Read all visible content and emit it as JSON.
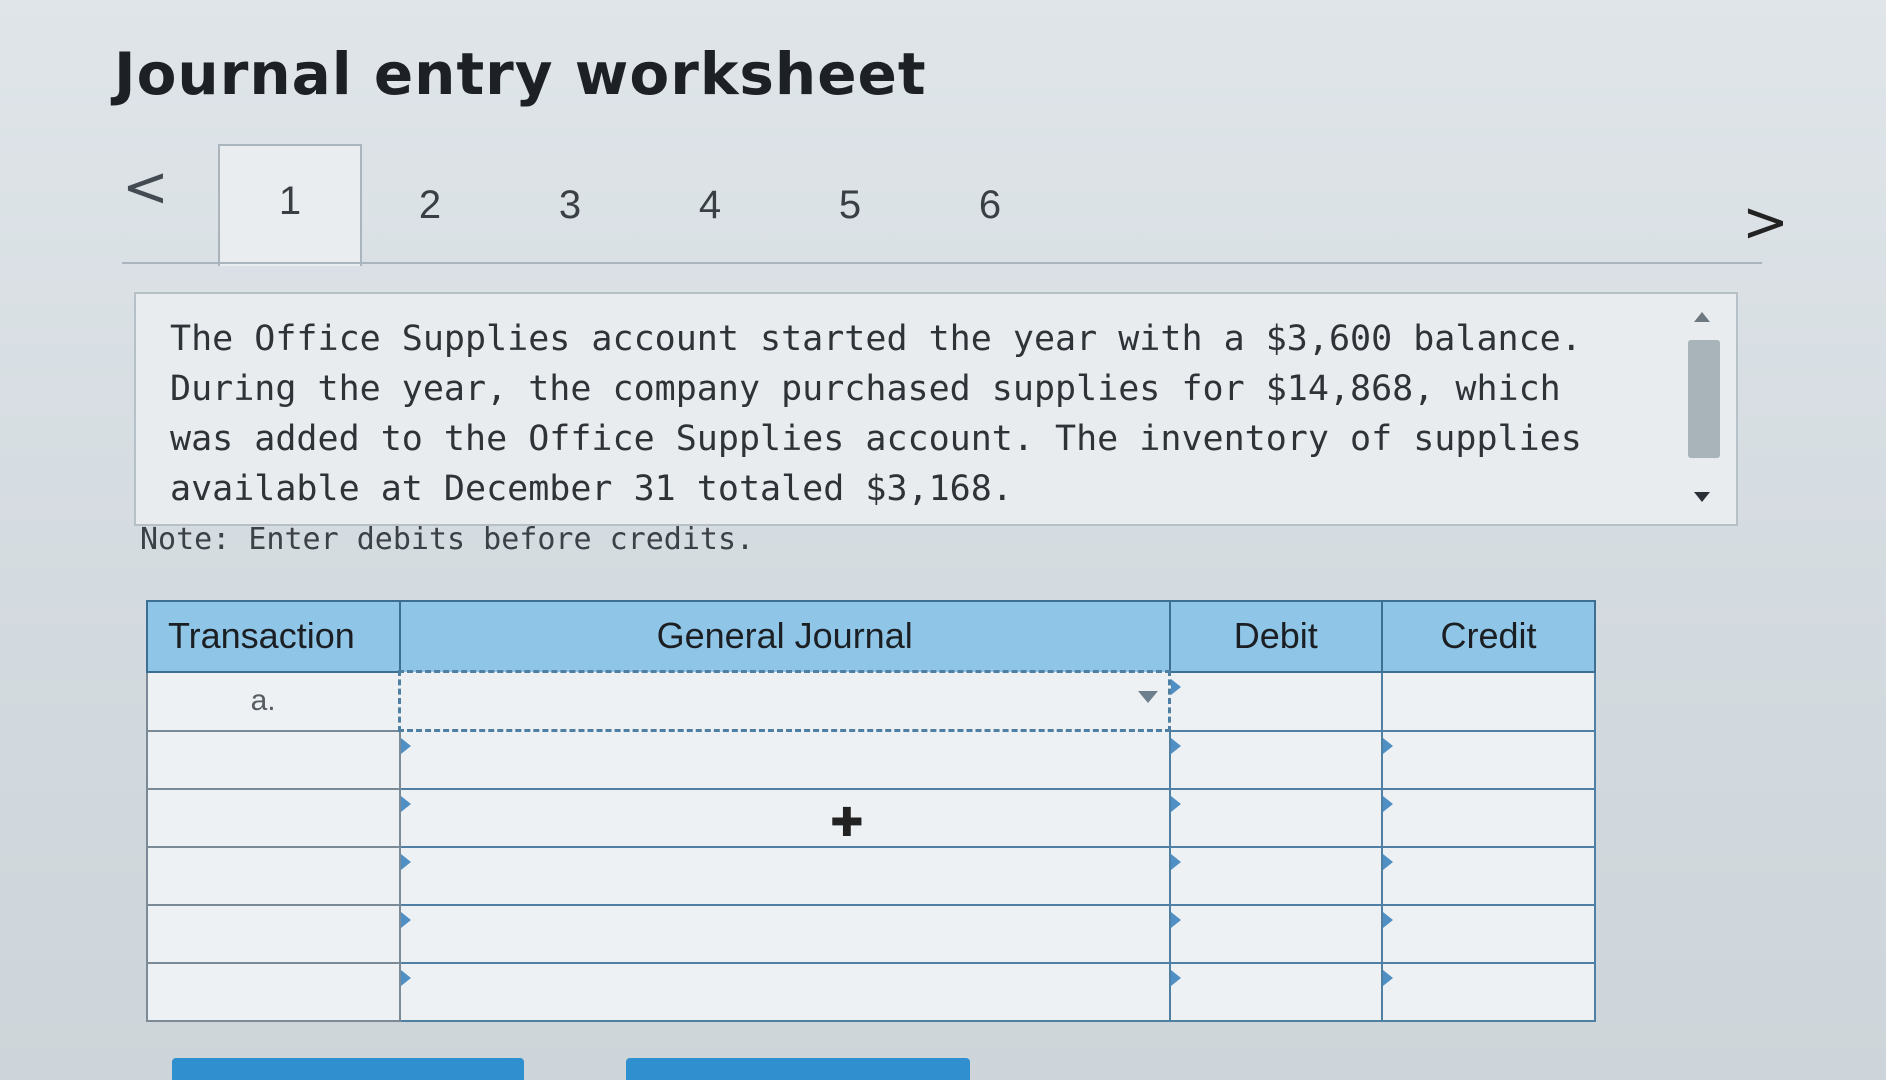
{
  "header": {
    "title": "Journal entry worksheet"
  },
  "navigation": {
    "prev_label": "<",
    "next_label": ">",
    "tabs": [
      "1",
      "2",
      "3",
      "4",
      "5",
      "6"
    ],
    "active_tab": "1"
  },
  "question": {
    "text": "The Office Supplies account started the year with a $3,600 balance. During the year, the company purchased supplies for $14,868, which was added to the Office Supplies account. The inventory of supplies available at December 31 totaled $3,168."
  },
  "note": "Note: Enter debits before credits.",
  "journal_table": {
    "headers": {
      "transaction": "Transaction",
      "general_journal": "General Journal",
      "debit": "Debit",
      "credit": "Credit"
    },
    "rows": [
      {
        "transaction": "a.",
        "account": "",
        "debit": "",
        "credit": ""
      },
      {
        "transaction": "",
        "account": "",
        "debit": "",
        "credit": ""
      },
      {
        "transaction": "",
        "account": "",
        "debit": "",
        "credit": ""
      },
      {
        "transaction": "",
        "account": "",
        "debit": "",
        "credit": ""
      },
      {
        "transaction": "",
        "account": "",
        "debit": "",
        "credit": ""
      },
      {
        "transaction": "",
        "account": "",
        "debit": "",
        "credit": ""
      }
    ]
  },
  "colors": {
    "header_fill": "#8fc5e6",
    "header_border": "#3d6f92",
    "button_blue": "#2f8fcf"
  }
}
